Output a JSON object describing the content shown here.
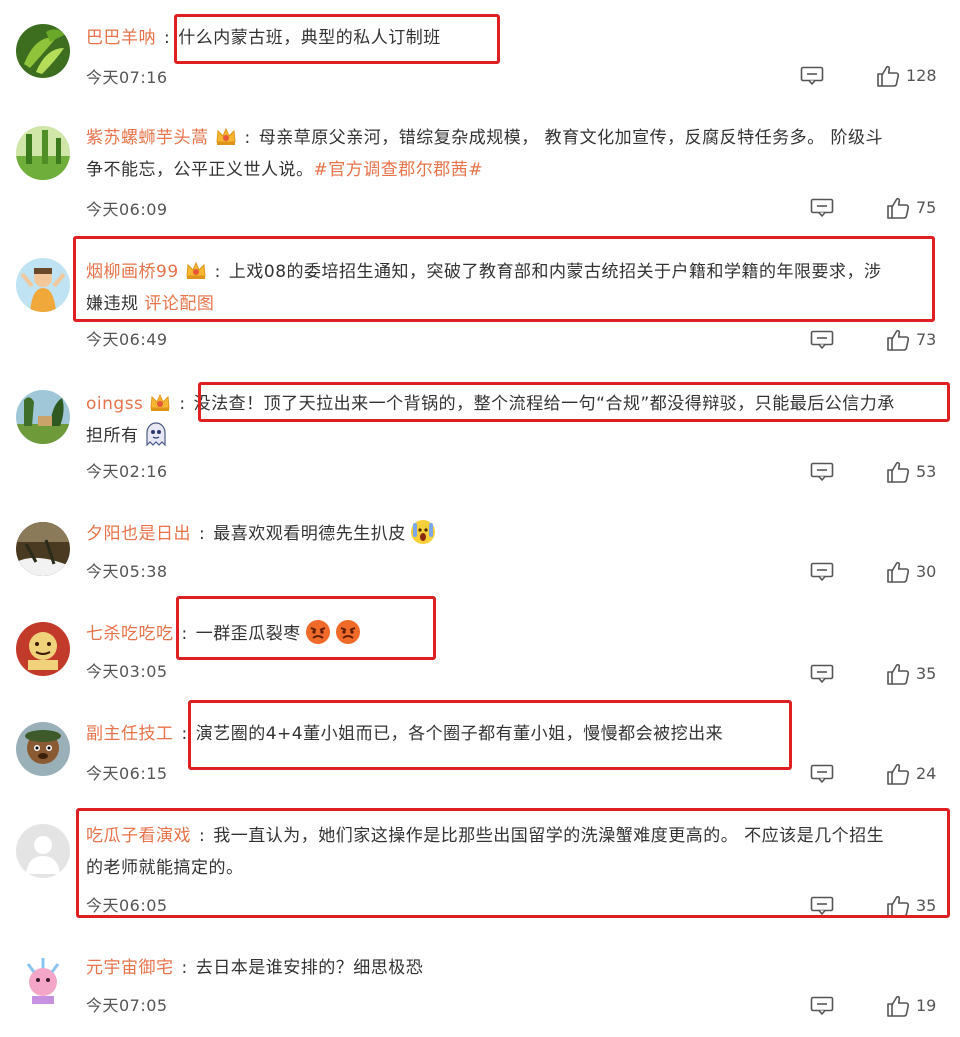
{
  "colors": {
    "username": "#e8734a",
    "highlight_box": "#e02020",
    "text": "#333333",
    "meta": "#555555"
  },
  "comments": [
    {
      "username": "巴巴羊呐",
      "text": "什么内蒙古班，典型的私人订制班",
      "time": "今天07:16",
      "likes": "128",
      "badge": false
    },
    {
      "username": "紫苏螺蛳芋头蒿",
      "text": "母亲草原父亲河，错综复杂成规模， 教育文化加宣传，反腐反特任务多。 阶级斗",
      "text2": "争不能忘，公平正义世人说。",
      "hashtag": "#官方调查郡尔郡茜#",
      "time": "今天06:09",
      "likes": "75",
      "badge": true
    },
    {
      "username": "烟柳画桥99",
      "text": "上戏08的委培招生通知，突破了教育部和内蒙古统招关于户籍和学籍的年限要求，涉",
      "text2": "嫌违规",
      "link": "评论配图",
      "time": "今天06:49",
      "likes": "73",
      "badge": true
    },
    {
      "username": "oingss",
      "text": "没法查！顶了天拉出来一个背锅的，整个流程给一句“合规”都没得辩驳，只能最后公信力承",
      "text2": "担所有",
      "time": "今天02:16",
      "likes": "53",
      "badge": true
    },
    {
      "username": "夕阳也是日出",
      "text": "最喜欢观看明德先生扒皮",
      "time": "今天05:38",
      "likes": "30",
      "badge": false
    },
    {
      "username": "七杀吃吃吃",
      "text": "一群歪瓜裂枣",
      "time": "今天03:05",
      "likes": "35",
      "badge": false
    },
    {
      "username": "副主任技工",
      "text": "演艺圈的4+4董小姐而已，各个圈子都有董小姐，慢慢都会被挖出来",
      "time": "今天06:15",
      "likes": "24",
      "badge": false
    },
    {
      "username": "吃瓜子看演戏",
      "text": "我一直认为，她们家这操作是比那些出国留学的洗澡蟹难度更高的。 不应该是几个招生",
      "text2": "的老师就能搞定的。",
      "time": "今天06:05",
      "likes": "35",
      "badge": false
    },
    {
      "username": "元宇宙御宅",
      "text": "去日本是谁安排的？细思极恐",
      "time": "今天07:05",
      "likes": "19",
      "badge": false
    }
  ]
}
